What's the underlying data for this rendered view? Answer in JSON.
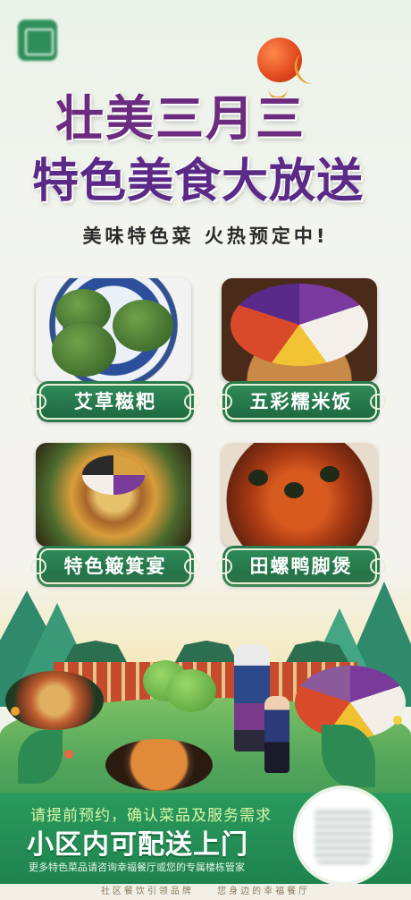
{
  "header": {
    "title_line1": "壮美三月三",
    "title_line2": "特色美食大放送",
    "subtitle": "美味特色菜 火热预定中!"
  },
  "dishes": [
    {
      "name": "艾草糍粑"
    },
    {
      "name": "五彩糯米饭"
    },
    {
      "name": "特色簸箕宴"
    },
    {
      "name": "田螺鸭脚煲"
    }
  ],
  "bottom": {
    "notice": "请提前预约，确认菜品及服务需求",
    "headline": "小区内可配送上门",
    "detail": "更多特色菜品请咨询幸福餐厅或您的专属楼栋管家"
  },
  "footer": {
    "left": "社区餐饮引领品牌",
    "right": "您身边的幸福餐厅"
  },
  "colors": {
    "accent_green": "#2a8a58",
    "title_purple": "#5a2a86",
    "notice_yellow": "#d9f7a8"
  }
}
